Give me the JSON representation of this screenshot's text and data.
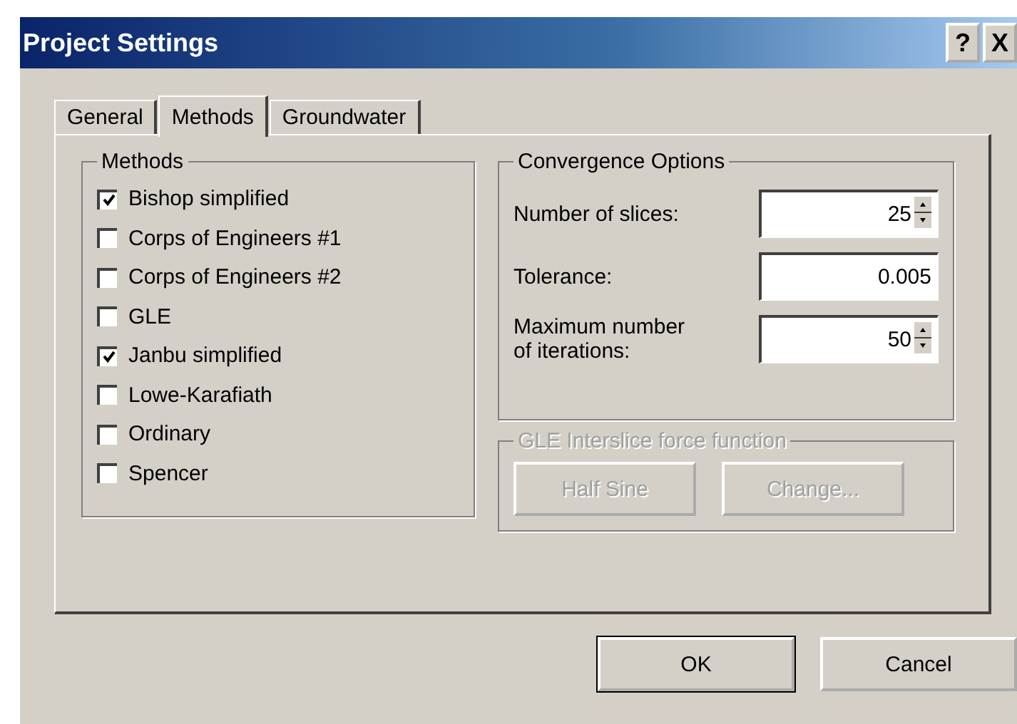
{
  "window": {
    "title": "Project Settings",
    "help": "?",
    "close": "X"
  },
  "tabs": [
    {
      "label": "General",
      "selected": false
    },
    {
      "label": "Methods",
      "selected": true
    },
    {
      "label": "Groundwater",
      "selected": false
    }
  ],
  "methods": {
    "title": "Methods",
    "items": [
      {
        "label": "Bishop simplified",
        "checked": true
      },
      {
        "label": "Corps of Engineers #1",
        "checked": false
      },
      {
        "label": "Corps of Engineers #2",
        "checked": false
      },
      {
        "label": "GLE",
        "checked": false
      },
      {
        "label": "Janbu simplified",
        "checked": true
      },
      {
        "label": "Lowe-Karafiath",
        "checked": false
      },
      {
        "label": "Ordinary",
        "checked": false
      },
      {
        "label": "Spencer",
        "checked": false
      }
    ]
  },
  "convergence": {
    "title": "Convergence Options",
    "fields": [
      {
        "label": "Number of slices:",
        "value": "25",
        "kind": "spin"
      },
      {
        "label": "Tolerance:",
        "value": "0.005",
        "kind": "text"
      },
      {
        "label": "Maximum number of iterations:",
        "value": "50",
        "kind": "spin"
      }
    ]
  },
  "interslice": {
    "title": "GLE Interslice force function",
    "disabled": true,
    "buttons": [
      "Half Sine",
      "Change..."
    ]
  },
  "buttons": [
    {
      "label": "OK",
      "default": true
    },
    {
      "label": "Cancel",
      "default": false
    }
  ]
}
